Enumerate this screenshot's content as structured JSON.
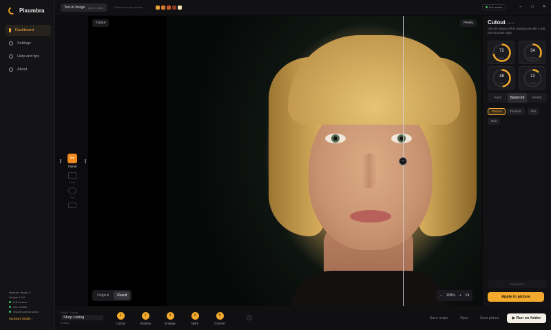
{
  "app": {
    "name": "Pixumbra"
  },
  "nav": [
    {
      "label": "Dashboard",
      "active": true
    },
    {
      "label": "Settings",
      "active": false
    },
    {
      "label": "Help and tips",
      "active": false
    },
    {
      "label": "About",
      "active": false
    }
  ],
  "footer": {
    "product": "Makeem Studio X",
    "version": "Version 1.0.0",
    "statuses": [
      "Full version",
      "Not verified",
      "Smooth performance"
    ],
    "hw_link": "Hardware details ›"
  },
  "topbar": {
    "file_name": "Test AI Image",
    "file_dims": "1264 × 1280",
    "hint": "Palette from this picture",
    "swatches": [
      "#e9a13b",
      "#d97a2a",
      "#c55a2a",
      "#8e3a22",
      "#f3e3b0"
    ],
    "status_label": "Full version",
    "window": [
      "–",
      "□",
      "✕"
    ]
  },
  "tools": {
    "active": "Cutout",
    "others": [
      "Frame",
      "Tone",
      "Fx"
    ]
  },
  "canvas": {
    "badge": "Cutout",
    "status": "Ready",
    "compare": [
      "Original",
      "Result"
    ],
    "compare_active": "Result",
    "zoom": {
      "minus": "−",
      "value": "100%",
      "plus": "+",
      "fit": "Fit"
    }
  },
  "panel": {
    "title": "Cutout",
    "tag": "Ctrl+1",
    "description": "Lifts the subject off its background with a soft, hair-accurate edge.",
    "dials": [
      {
        "value": "72",
        "label": "Edge",
        "fraction": 0.72
      },
      {
        "value": "34",
        "label": "Feather",
        "fraction": 0.34
      },
      {
        "value": "48",
        "label": "Shift",
        "fraction": 0.48
      },
      {
        "value": "12",
        "label": "Smooth",
        "fraction": 0.12
      }
    ],
    "speed": [
      "Fast",
      "Balanced",
      "Finest"
    ],
    "speed_active": "Balanced",
    "subjects": [
      "Person",
      "Product",
      "Pet",
      "Hair"
    ],
    "subject_active": "Person",
    "step_back": "Step back",
    "apply": "Apply to picture"
  },
  "bottom": {
    "recipe_caption": "Recipe · 5 steps",
    "recipe_name": "Shop Listing",
    "recipe_steps": "5 steps",
    "steps": [
      {
        "n": "1",
        "label": "Cutout"
      },
      {
        "n": "2",
        "label": "Shadow"
      },
      {
        "n": "3",
        "label": "Enlarge"
      },
      {
        "n": "4",
        "label": "Mark"
      },
      {
        "n": "5",
        "label": "Convert"
      }
    ],
    "add": "+",
    "save_recipe": "Save recipe",
    "open": "Open",
    "save_picture": "Save picture",
    "run": "Run on folder"
  },
  "colors": {
    "accent": "#f2a92c",
    "ok": "#3fc66d"
  }
}
